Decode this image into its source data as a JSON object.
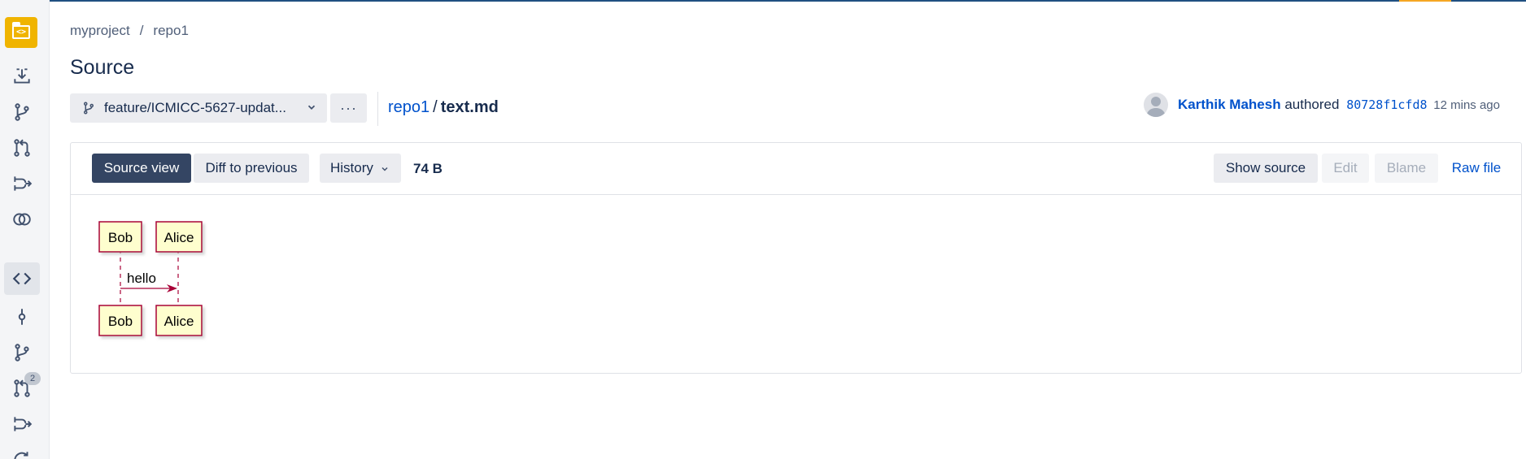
{
  "breadcrumb": {
    "project": "myproject",
    "separator": "/",
    "repo": "repo1"
  },
  "page": {
    "title": "Source"
  },
  "branch": {
    "label": "feature/ICMICC-5627-updat..."
  },
  "more_label": "···",
  "file_path": {
    "repo": "repo1",
    "separator": "/",
    "file": "text.md"
  },
  "commit": {
    "author": "Karthik Mahesh",
    "verb": "authored",
    "hash": "80728f1cfd8",
    "time": "12 mins ago"
  },
  "toolbar": {
    "source_view": "Source view",
    "diff_to_previous": "Diff to previous",
    "history": "History",
    "size": "74 B",
    "show_source": "Show source",
    "edit": "Edit",
    "blame": "Blame",
    "raw_file": "Raw file"
  },
  "sidebar": {
    "items": [
      {
        "icon": "clone-icon"
      },
      {
        "icon": "create-branch-icon"
      },
      {
        "icon": "create-pull-request-icon"
      },
      {
        "icon": "fork-icon"
      },
      {
        "icon": "compare-icon"
      },
      {
        "icon": "source-icon",
        "active": true
      },
      {
        "icon": "commits-icon"
      },
      {
        "icon": "branches-icon"
      },
      {
        "icon": "pull-requests-icon",
        "badge": "2"
      },
      {
        "icon": "forks-icon"
      }
    ]
  },
  "diagram": {
    "participants": [
      "Bob",
      "Alice"
    ],
    "message": "hello",
    "colors": {
      "box_fill": "#fefece",
      "box_stroke": "#a80036",
      "arrow": "#a80036"
    }
  },
  "colors": {
    "accent": "#0052cc",
    "primary_button": "#344563",
    "logo": "#f0b400"
  }
}
